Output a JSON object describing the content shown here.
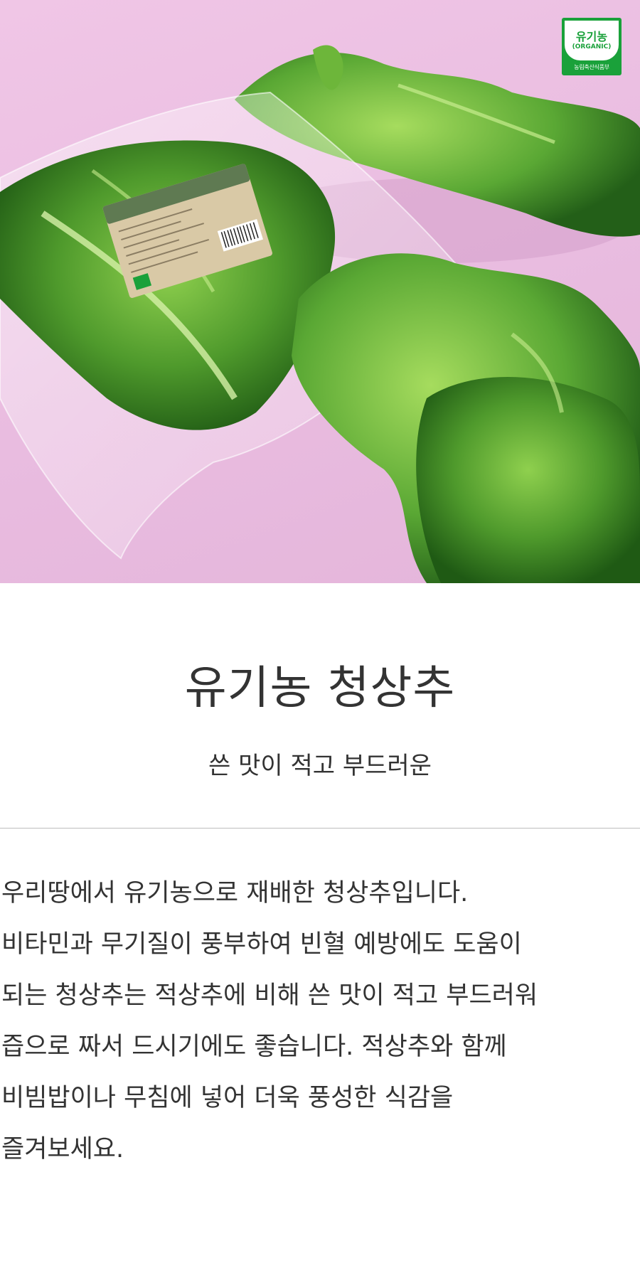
{
  "hero": {
    "badge": {
      "title": "유기농",
      "subtitle": "(ORGANIC)",
      "footer": "농림축산식품부"
    },
    "colors": {
      "background": "#ecc0e2",
      "lettuce": "#4f9a2c",
      "label": "#d9c9a6",
      "badge": "#1aa13a"
    }
  },
  "product": {
    "title": "유기농 청상추",
    "subtitle": "쓴 맛이 적고 부드러운"
  },
  "description": {
    "lines": [
      "우리땅에서 유기농으로 재배한 청상추입니다.",
      "비타민과 무기질이 풍부하여 빈혈 예방에도 도움이",
      "되는 청상추는 적상추에 비해 쓴 맛이 적고 부드러워",
      "즙으로 짜서 드시기에도 좋습니다. 적상추와 함께",
      "비빔밥이나 무침에 넣어 더욱 풍성한 식감을",
      "즐겨보세요."
    ]
  }
}
